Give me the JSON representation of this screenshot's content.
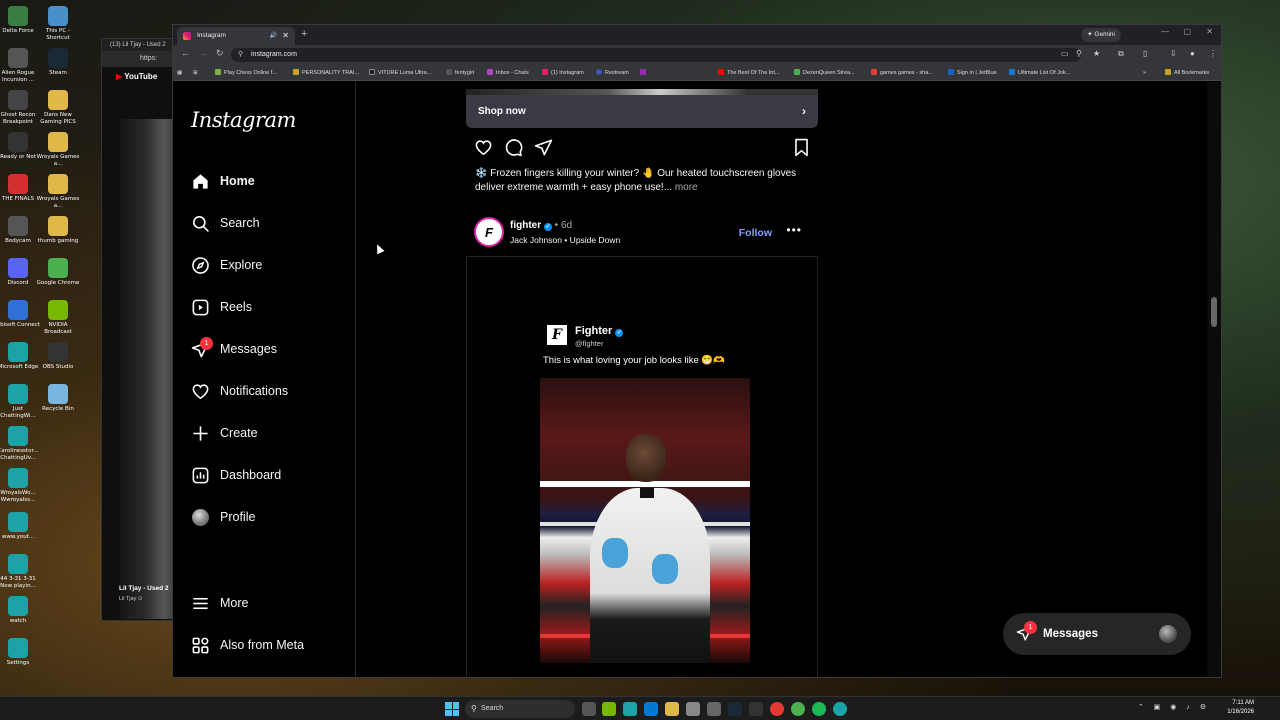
{
  "desktop": {
    "icons": [
      {
        "label": "Delta Force",
        "color": "#3a7d44"
      },
      {
        "label": "This PC - Shortcut",
        "color": "#4a90c8"
      },
      {
        "label": "Alien Rogue Incursion ...",
        "color": "#555"
      },
      {
        "label": "Steam",
        "color": "#1b2838"
      },
      {
        "label": "Ghost Recon Breakpoint",
        "color": "#444"
      },
      {
        "label": "Dans New Gaming PICS",
        "color": "#e0b84a"
      },
      {
        "label": "Ready or Not",
        "color": "#333"
      },
      {
        "label": "Wroyals Games a...",
        "color": "#e0b84a"
      },
      {
        "label": "THE FINALS",
        "color": "#d32f2f"
      },
      {
        "label": "Wroyals Games a...",
        "color": "#e0b84a"
      },
      {
        "label": "Bodycam",
        "color": "#555"
      },
      {
        "label": "thumb gaming",
        "color": "#e0b84a"
      },
      {
        "label": "Discord",
        "color": "#5865f2"
      },
      {
        "label": "Google Chrome",
        "color": "#4caf50"
      },
      {
        "label": "Ubisoft Connect",
        "color": "#2f6fd6"
      },
      {
        "label": "NVIDIA Broadcast",
        "color": "#76b900"
      },
      {
        "label": "Microsoft Edge",
        "color": "#1ba3a8"
      },
      {
        "label": "OBS Studio",
        "color": "#333"
      },
      {
        "label": "Just ChattingWi...",
        "color": "#1ba3a8"
      },
      {
        "label": "Recycle Bin",
        "color": "#7ab6e0"
      },
      {
        "label": "Carolinesstor... ChattingUv...",
        "color": "#1ba3a8"
      },
      {
        "label": "WroyalsWo... Wwroyalss...",
        "color": "#1ba3a8"
      },
      {
        "label": "www.yout...",
        "color": "#1ba3a8"
      },
      {
        "label": "44 3-31 3-31 Now playin...",
        "color": "#1ba3a8"
      },
      {
        "label": "watch",
        "color": "#1ba3a8"
      },
      {
        "label": "Settings",
        "color": "#1ba3a8"
      }
    ]
  },
  "background_window": {
    "tab_title": "(13) Lil Tjay - Used 2",
    "address": "https:",
    "site": "YouTube",
    "video_title": "Lil Tjay - Used 2",
    "channel": "Lil Tjay ⊙"
  },
  "browser": {
    "tab_title": "Instagram",
    "url": "instagram.com",
    "gemini_label": "Gemini",
    "bookmarks": [
      "Play Chess Online f...",
      "PERSONALITY TRAI...",
      "VITURE Luma Ultra...",
      "fentygirl",
      "Inbox - Chats",
      "(1) Instagram",
      "Restream",
      "The Best Of The Int...",
      "DezenQueen Strea...",
      "games games - sha...",
      "Sign in | JetBlue",
      "Ultimate List Of Jok...",
      "All Bookmarks"
    ]
  },
  "instagram": {
    "logo": "Instagram",
    "nav": [
      {
        "label": "Home",
        "icon": "home-icon"
      },
      {
        "label": "Search",
        "icon": "search-icon"
      },
      {
        "label": "Explore",
        "icon": "explore-icon"
      },
      {
        "label": "Reels",
        "icon": "reels-icon"
      },
      {
        "label": "Messages",
        "icon": "messages-icon",
        "badge": "1"
      },
      {
        "label": "Notifications",
        "icon": "heart-icon"
      },
      {
        "label": "Create",
        "icon": "plus-icon"
      },
      {
        "label": "Dashboard",
        "icon": "dashboard-icon"
      },
      {
        "label": "Profile",
        "icon": "avatar"
      }
    ],
    "more_label": "More",
    "also_meta_label": "Also from Meta",
    "ad": {
      "shop_now": "Shop now",
      "caption": "❄️ Frozen fingers killing your winter? 🤚 Our heated touchscreen gloves deliver extreme warmth + easy phone use!...",
      "more": "more"
    },
    "post": {
      "username": "fighter",
      "age": "6d",
      "audio": "Jack Johnson • Upside Down",
      "follow": "Follow",
      "tweet_name": "Fighter",
      "tweet_handle": "@fighter",
      "tweet_text": "This is what loving your job looks like 😁🫶"
    },
    "messages_pill": {
      "label": "Messages",
      "badge": "1"
    }
  },
  "taskbar": {
    "search": "Search",
    "time": "7:11 AM",
    "date": "1/16/2026"
  }
}
